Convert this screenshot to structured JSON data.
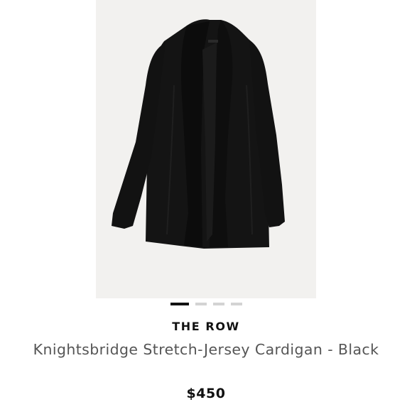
{
  "product": {
    "brand": "THE ROW",
    "name": "Knightsbridge Stretch-Jersey Cardigan - Black",
    "price": "$450"
  },
  "gallery": {
    "image_count": 4,
    "active_index": 0,
    "image_subject": "black open-front cardigan"
  },
  "colors": {
    "image_background": "#f2f1ef",
    "garment": "#141414",
    "dot_active": "#111111",
    "dot_inactive": "#d3d3d3",
    "brand_text": "#111111",
    "name_text": "#555555",
    "price_text": "#111111"
  }
}
